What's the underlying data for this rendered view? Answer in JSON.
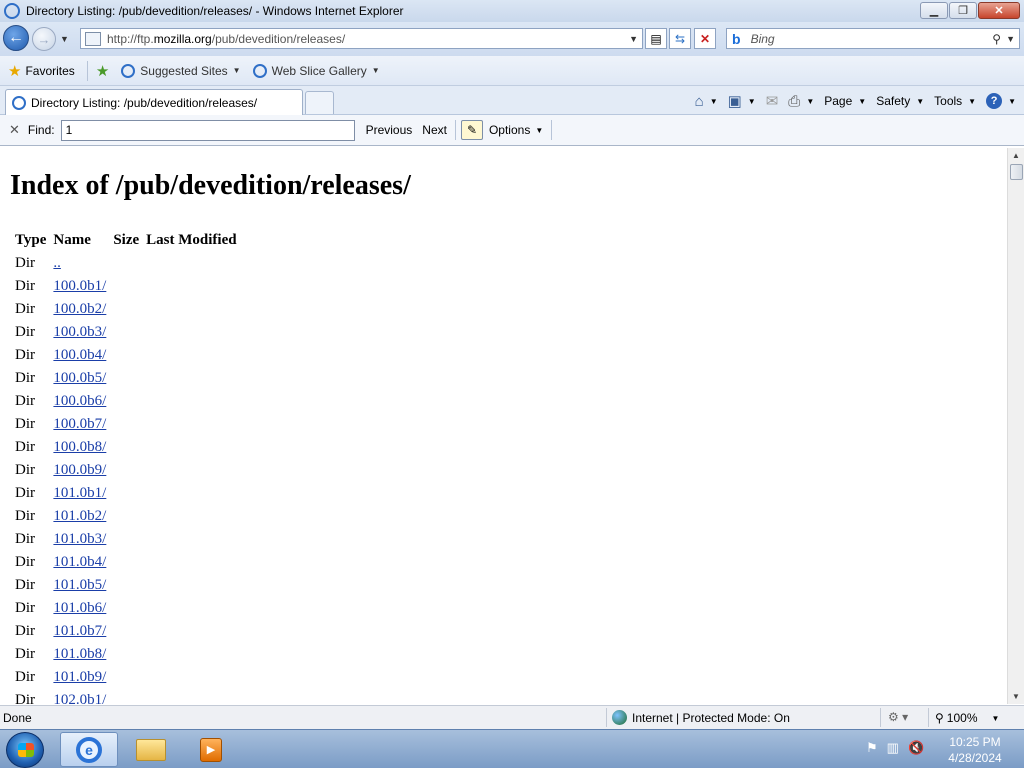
{
  "window": {
    "title": "Directory Listing: /pub/devedition/releases/ - Windows Internet Explorer",
    "minimize": "▁",
    "restore": "❐",
    "close": "✕"
  },
  "address": {
    "url_prefix": "http://ftp.",
    "url_domain": "mozilla.org",
    "url_path": "/pub/devedition/releases/"
  },
  "search": {
    "placeholder": "Bing"
  },
  "favorites_bar": {
    "favorites_label": "Favorites",
    "suggested_sites": "Suggested Sites",
    "web_slice_gallery": "Web Slice Gallery"
  },
  "tab": {
    "title": "Directory Listing: /pub/devedition/releases/"
  },
  "command_bar": {
    "page": "Page",
    "safety": "Safety",
    "tools": "Tools",
    "help": "?"
  },
  "find_bar": {
    "label": "Find:",
    "value": "1",
    "previous": "Previous",
    "next": "Next",
    "options": "Options"
  },
  "page": {
    "heading": "Index of /pub/devedition/releases/",
    "columns": [
      "Type",
      "Name",
      "Size",
      "Last Modified"
    ],
    "rows": [
      {
        "type": "Dir",
        "name": ".."
      },
      {
        "type": "Dir",
        "name": "100.0b1/"
      },
      {
        "type": "Dir",
        "name": "100.0b2/"
      },
      {
        "type": "Dir",
        "name": "100.0b3/"
      },
      {
        "type": "Dir",
        "name": "100.0b4/"
      },
      {
        "type": "Dir",
        "name": "100.0b5/"
      },
      {
        "type": "Dir",
        "name": "100.0b6/"
      },
      {
        "type": "Dir",
        "name": "100.0b7/"
      },
      {
        "type": "Dir",
        "name": "100.0b8/"
      },
      {
        "type": "Dir",
        "name": "100.0b9/"
      },
      {
        "type": "Dir",
        "name": "101.0b1/"
      },
      {
        "type": "Dir",
        "name": "101.0b2/"
      },
      {
        "type": "Dir",
        "name": "101.0b3/"
      },
      {
        "type": "Dir",
        "name": "101.0b4/"
      },
      {
        "type": "Dir",
        "name": "101.0b5/"
      },
      {
        "type": "Dir",
        "name": "101.0b6/"
      },
      {
        "type": "Dir",
        "name": "101.0b7/"
      },
      {
        "type": "Dir",
        "name": "101.0b8/"
      },
      {
        "type": "Dir",
        "name": "101.0b9/"
      },
      {
        "type": "Dir",
        "name": "102.0b1/"
      }
    ]
  },
  "status_bar": {
    "status": "Done",
    "zone": "Internet | Protected Mode: On",
    "zoom": "100%"
  },
  "taskbar": {
    "time": "10:25 PM",
    "date": "4/28/2024"
  },
  "colors": {
    "link": "#1a3ea8",
    "chrome": "#dce7f5"
  }
}
